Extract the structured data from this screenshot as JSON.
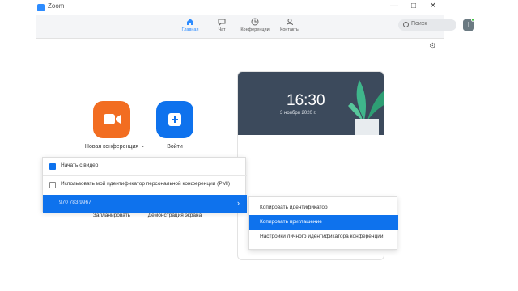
{
  "window": {
    "title": "Zoom",
    "controls": [
      "—",
      "□",
      "✕"
    ]
  },
  "nav": {
    "items": [
      {
        "label": "Главная",
        "icon": "home-icon",
        "active": true
      },
      {
        "label": "Чат",
        "icon": "chat-icon",
        "active": false
      },
      {
        "label": "Конференции",
        "icon": "clock-icon",
        "active": false
      },
      {
        "label": "Контакты",
        "icon": "contacts-icon",
        "active": false
      }
    ],
    "search_placeholder": "Поиск",
    "avatar_initial": "I"
  },
  "tiles": {
    "new_meeting": "Новая конференция",
    "join": "Войти",
    "schedule": "Запланировать",
    "share_screen": "Демонстрация экрана"
  },
  "calendar": {
    "time": "16:30",
    "date": "3 ноября 2020 г."
  },
  "dropdown": {
    "start_video": "Начать с видео",
    "use_pmi": "Использовать мой идентификатор персональной конференции (PMI)",
    "pmi_number": "970 783 9967"
  },
  "submenu": {
    "copy_id": "Копировать идентификатор",
    "copy_invite": "Копировать приглашение",
    "pmi_settings": "Настройки личного идентификатора конференции"
  },
  "colors": {
    "accent": "#0e72ed",
    "orange": "#f26d21",
    "hero": "#3c4a5c"
  }
}
